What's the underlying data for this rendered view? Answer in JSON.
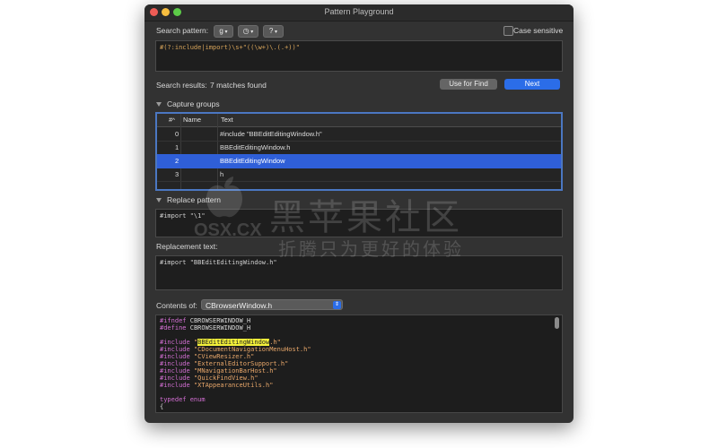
{
  "window": {
    "title": "Pattern Playground"
  },
  "search": {
    "label": "Search pattern:",
    "btn1": "g",
    "btn2": "◷",
    "btn3": "?",
    "case_label": "Case sensitive",
    "pattern": "#(?:include|import)\\s+\"((\\w+)\\.(.+))\""
  },
  "results": {
    "label": "Search results:",
    "count": "7 matches found",
    "use_for_find": "Use for Find",
    "next": "Next"
  },
  "groups": {
    "title": "Capture groups",
    "headers": {
      "num": "#",
      "name": "Name",
      "text": "Text"
    },
    "rows": [
      {
        "num": "0",
        "name": "",
        "text": "#include \"BBEditEditingWindow.h\""
      },
      {
        "num": "1",
        "name": "",
        "text": "BBEditEditingWindow.h"
      },
      {
        "num": "2",
        "name": "",
        "text": "BBEditEditingWindow"
      },
      {
        "num": "3",
        "name": "",
        "text": "h"
      }
    ]
  },
  "replace": {
    "title": "Replace pattern",
    "value": "#import \"\\1\""
  },
  "replacement": {
    "label": "Replacement text:",
    "value": "#import \"BBEditEditingWindow.h\""
  },
  "contents": {
    "label": "Contents of:",
    "file": "CBrowserWindow.h",
    "line1": {
      "kw": "#ifndef",
      "rest": " CBROWSERWINDOW_H"
    },
    "line2": {
      "kw": "#define",
      "rest": " CBROWSERWINDOW_H"
    },
    "includes": [
      {
        "kw": "#include",
        "pre": " \"",
        "hl": "BBEditEditingWindow",
        "post": ".h\""
      },
      {
        "kw": "#include",
        "str": " \"CDocumentNavigationMenuHost.h\""
      },
      {
        "kw": "#include",
        "str": " \"CViewResizer.h\""
      },
      {
        "kw": "#include",
        "str": " \"ExternalEditorSupport.h\""
      },
      {
        "kw": "#include",
        "str": " \"MNavigationBarHost.h\""
      },
      {
        "kw": "#include",
        "str": " \"QuickFindView.h\""
      },
      {
        "kw": "#include",
        "str": " \"XTAppearanceUtils.h\""
      }
    ],
    "typedef": "typedef enum",
    "brace": "{"
  },
  "watermark": {
    "cn": "黑苹果社区",
    "osx": "OSX.CX",
    "slogan": "折腾只为更好的体验"
  }
}
